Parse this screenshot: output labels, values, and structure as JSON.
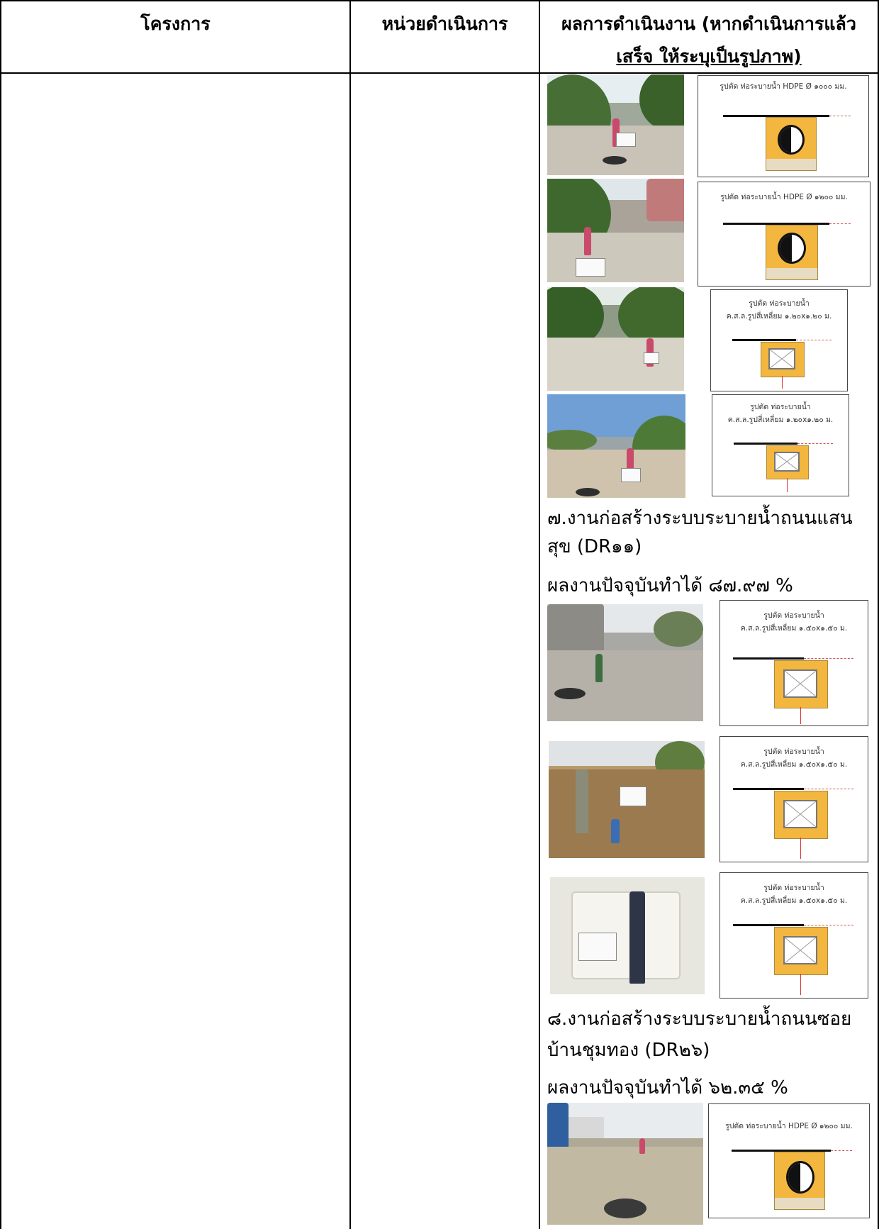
{
  "table": {
    "headers": {
      "project": "โครงการ",
      "agency": "หน่วยดำเนินการ",
      "result_line1": "ผลการดำเนินงาน (หากดำเนินการแล้ว",
      "result_line2": "เสร็จ ให้ระบุเป็นรูปภาพ)"
    }
  },
  "diagrams": {
    "d1": "รูปตัด ท่อระบายน้ำ HDPE Ø ๑๐๐๐ มม.",
    "d2": "รูปตัด ท่อระบายน้ำ HDPE Ø ๑๒๐๐ มม.",
    "d3_line1": "รูปตัด ท่อระบายน้ำ",
    "d3_line2": "ค.ส.ล.รูปสี่เหลี่ยม ๑.๒๐x๑.๒๐ ม.",
    "d4_line1": "รูปตัด ท่อระบายน้ำ",
    "d4_line2": "ค.ส.ล.รูปสี่เหลี่ยม ๑.๒๐x๑.๒๐ ม.",
    "d5_line1": "รูปตัด ท่อระบายน้ำ",
    "d5_line2": "ค.ส.ล.รูปสี่เหลี่ยม ๑.๕๐x๑.๕๐ ม.",
    "d6_line1": "รูปตัด ท่อระบายน้ำ",
    "d6_line2": "ค.ส.ล.รูปสี่เหลี่ยม ๑.๕๐x๑.๕๐ ม.",
    "d7_line1": "รูปตัด ท่อระบายน้ำ",
    "d7_line2": "ค.ส.ล.รูปสี่เหลี่ยม ๑.๕๐x๑.๕๐ ม.",
    "d8": "รูปตัด ท่อระบายน้ำ HDPE Ø ๑๒๐๐ มม."
  },
  "items": {
    "item7_line1": "๗.งานก่อสร้างระบบระบายน้ำถนนแสน",
    "item7_line2": "สุข (DR๑๑)",
    "item7_progress": "ผลงานปัจจุบันทำได้  ๘๗.๙๗ %",
    "item8_line1": "๘.งานก่อสร้างระบบระบายน้ำถนนซอย",
    "item8_line2": "บ้านชุมทอง (DR๒๖)",
    "item8_progress": "ผลงานปัจจุบันทำได้  ๖๒.๓๕ %"
  },
  "colors": {
    "border": "#000000",
    "soil": "#f3b63f",
    "road": "#c9c4b8",
    "foliage": "#3f6d2f"
  }
}
